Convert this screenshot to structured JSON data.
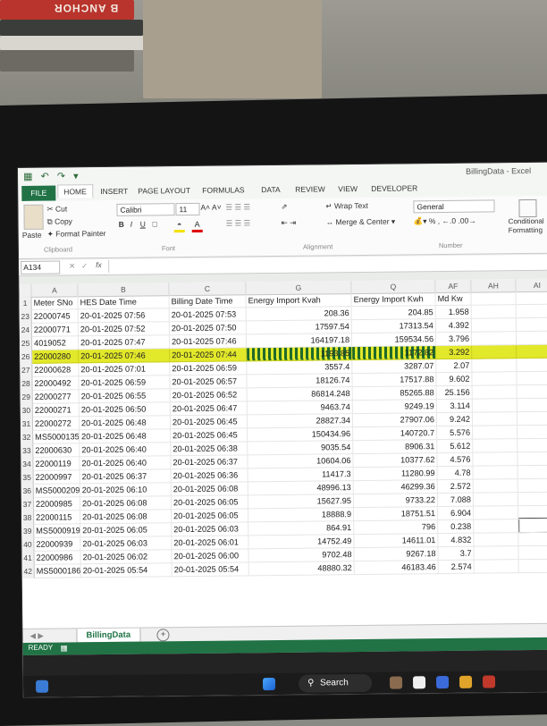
{
  "window": {
    "title": "BillingData - Excel"
  },
  "ribbon": {
    "tabs": [
      "FILE",
      "HOME",
      "INSERT",
      "PAGE LAYOUT",
      "FORMULAS",
      "DATA",
      "REVIEW",
      "VIEW",
      "DEVELOPER"
    ],
    "clipboard": {
      "cut": "Cut",
      "copy": "Copy",
      "paste": "Paste",
      "format_painter": "Format Painter",
      "group": "Clipboard"
    },
    "font": {
      "name": "Calibri",
      "size": "11",
      "group": "Font"
    },
    "alignment": {
      "wrap_text": "Wrap Text",
      "merge_center": "Merge & Center",
      "group": "Alignment"
    },
    "number": {
      "format": "General",
      "group": "Number"
    },
    "styles": {
      "conditional_formatting": "Conditional Formatting"
    }
  },
  "formula_bar": {
    "name_box": "A134",
    "fx": "fx"
  },
  "grid": {
    "column_letters": [
      "A",
      "B",
      "C",
      "G",
      "Q",
      "AF",
      "AH",
      "AI"
    ],
    "headers": [
      "Meter SNo",
      "HES Date Time",
      "Billing Date Time",
      "Energy Import Kvah",
      "Energy Import Kwh",
      "Md Kw"
    ],
    "rows": [
      {
        "n": "23",
        "cells": [
          "22000745",
          "20-01-2025 07:56",
          "20-01-2025 07:53",
          "208.36",
          "204.85",
          "1.958"
        ]
      },
      {
        "n": "24",
        "cells": [
          "22000771",
          "20-01-2025 07:52",
          "20-01-2025 07:50",
          "17597.54",
          "17313.54",
          "4.392"
        ]
      },
      {
        "n": "25",
        "cells": [
          "4019052",
          "20-01-2025 07:47",
          "20-01-2025 07:46",
          "164197.18",
          "159534.56",
          "3.796"
        ]
      },
      {
        "n": "26",
        "cells": [
          "22000280",
          "20-01-2025 07:46",
          "20-01-2025 07:44",
          "1193.85",
          "1172.82",
          "3.292"
        ],
        "highlight": true
      },
      {
        "n": "27",
        "cells": [
          "22000628",
          "20-01-2025 07:01",
          "20-01-2025 06:59",
          "3557.4",
          "3287.07",
          "2.07"
        ]
      },
      {
        "n": "28",
        "cells": [
          "22000492",
          "20-01-2025 06:59",
          "20-01-2025 06:57",
          "18126.74",
          "17517.88",
          "9.602"
        ]
      },
      {
        "n": "29",
        "cells": [
          "22000277",
          "20-01-2025 06:55",
          "20-01-2025 06:52",
          "86814.248",
          "85265.88",
          "25.156"
        ]
      },
      {
        "n": "30",
        "cells": [
          "22000271",
          "20-01-2025 06:50",
          "20-01-2025 06:47",
          "9463.74",
          "9249.19",
          "3.114"
        ]
      },
      {
        "n": "31",
        "cells": [
          "22000272",
          "20-01-2025 06:48",
          "20-01-2025 06:45",
          "28827.34",
          "27907.06",
          "9.242"
        ]
      },
      {
        "n": "32",
        "cells": [
          "MS5000135",
          "20-01-2025 06:48",
          "20-01-2025 06:45",
          "150434.96",
          "140720.7",
          "5.576"
        ]
      },
      {
        "n": "33",
        "cells": [
          "22000630",
          "20-01-2025 06:40",
          "20-01-2025 06:38",
          "9035.54",
          "8906.31",
          "5.612"
        ]
      },
      {
        "n": "34",
        "cells": [
          "22000119",
          "20-01-2025 06:40",
          "20-01-2025 06:37",
          "10604.06",
          "10377.62",
          "4.576"
        ]
      },
      {
        "n": "35",
        "cells": [
          "22000997",
          "20-01-2025 06:37",
          "20-01-2025 06:36",
          "11417.3",
          "11280.99",
          "4.78"
        ]
      },
      {
        "n": "36",
        "cells": [
          "MS5000209",
          "20-01-2025 06:10",
          "20-01-2025 06:08",
          "48996.13",
          "46299.36",
          "2.572"
        ]
      },
      {
        "n": "37",
        "cells": [
          "22000985",
          "20-01-2025 06:08",
          "20-01-2025 06:05",
          "15627.95",
          "9733.22",
          "7.088"
        ]
      },
      {
        "n": "38",
        "cells": [
          "22000115",
          "20-01-2025 06:08",
          "20-01-2025 06:05",
          "18888.9",
          "18751.51",
          "6.904"
        ]
      },
      {
        "n": "39",
        "cells": [
          "MS5000919",
          "20-01-2025 06:05",
          "20-01-2025 06:03",
          "864.91",
          "796",
          "0.238"
        ]
      },
      {
        "n": "40",
        "cells": [
          "22000939",
          "20-01-2025 06:03",
          "20-01-2025 06:01",
          "14752.49",
          "14611.01",
          "4.832"
        ]
      },
      {
        "n": "41",
        "cells": [
          "22000986",
          "20-01-2025 06:02",
          "20-01-2025 06:00",
          "9702.48",
          "9267.18",
          "3.7"
        ]
      },
      {
        "n": "42",
        "cells": [
          "MS5000186",
          "20-01-2025 05:54",
          "20-01-2025 05:54",
          "48880.32",
          "46183.46",
          "2.574"
        ]
      }
    ]
  },
  "sheet_tabs": {
    "active": "BillingData",
    "add": "+"
  },
  "status": {
    "text": "READY"
  },
  "taskbar": {
    "search": "Search"
  },
  "colors": {
    "excel_green": "#217346",
    "highlight": "#e2e82a"
  }
}
